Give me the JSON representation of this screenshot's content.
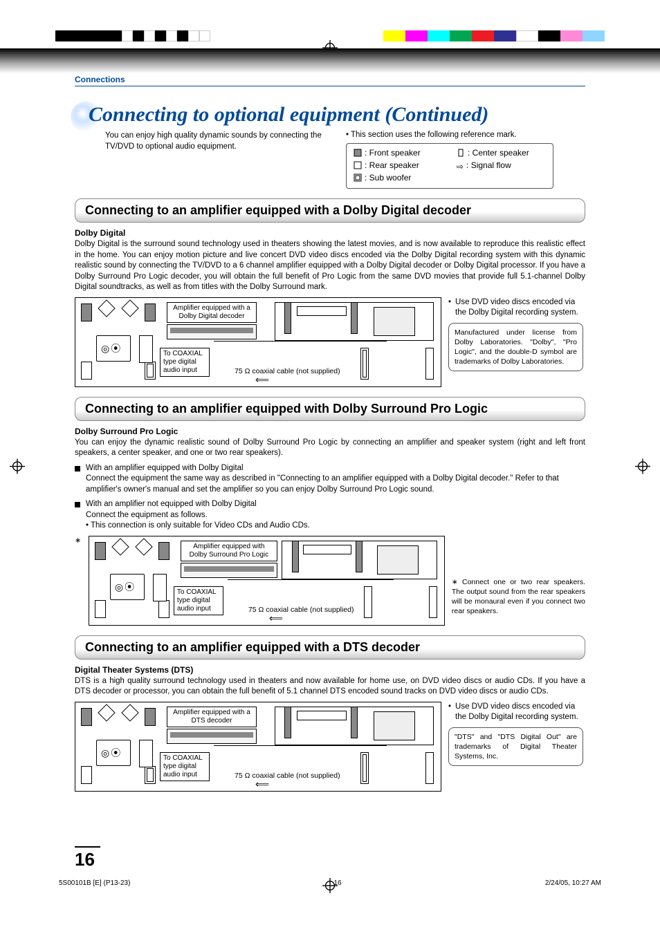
{
  "breadcrumb": "Connections",
  "title": "Connecting to optional equipment (Continued)",
  "intro_left": "You can enjoy high quality dynamic sounds by connecting the TV/DVD to optional audio equipment.",
  "intro_right": "• This section uses the following reference mark.",
  "legend": {
    "front": ": Front speaker",
    "rear": ": Rear speaker",
    "sub": ": Sub woofer",
    "center": ": Center speaker",
    "signal": ": Signal flow"
  },
  "sec1": {
    "heading": "Connecting to an amplifier equipped with a Dolby Digital decoder",
    "sub": "Dolby Digital",
    "para": "Dolby Digital is the surround sound technology used in theaters showing the latest movies, and is now available to reproduce this realistic effect in the home. You can enjoy motion picture and live concert DVD video discs encoded via the Dolby Digital recording system with this dynamic realistic sound by connecting the TV/DVD to a 6 channel amplifier equipped with a Dolby Digital decoder or Dolby Digital processor. If you have a Dolby Surround Pro Logic decoder, you will obtain the full benefit of Pro Logic from the same DVD movies that provide full 5.1-channel Dolby Digital soundtracks, as well as from titles with the Dolby Surround mark.",
    "amp_label": "Amplifier equipped with a Dolby Digital decoder",
    "coax_label": "To COAXIAL type digital audio input",
    "cable_label": "75 Ω coaxial cable (not supplied)",
    "side_bullet": "Use DVD video discs encoded via the Dolby Digital recording system.",
    "side_note": "Manufactured under license from Dolby Laboratories. \"Dolby\", \"Pro Logic\", and the double-D symbol are trademarks of Dolby Laboratories."
  },
  "sec2": {
    "heading": "Connecting to an amplifier equipped with Dolby Surround Pro Logic",
    "sub": "Dolby Surround Pro Logic",
    "para": "You can enjoy the dynamic realistic sound of Dolby Surround Pro Logic by connecting an amplifier and speaker system (right and left front speakers, a center speaker, and one or two rear speakers).",
    "b1_title": "With an amplifier equipped with Dolby Digital",
    "b1_body": "Connect the equipment the same way as described in \"Connecting to an amplifier equipped with a Dolby Digital decoder.\" Refer to that amplifier's owner's manual and set the amplifier so you can enjoy Dolby Surround Pro Logic sound.",
    "b2_title": "With an amplifier not equipped with Dolby Digital",
    "b2_body": "Connect the equipment as follows.",
    "b2_note": "• This connection is only suitable for Video CDs and Audio CDs.",
    "amp_label": "Amplifier equipped with Dolby Surround Pro Logic",
    "coax_label": "To COAXIAL type digital audio input",
    "cable_label": "75 Ω coaxial cable (not supplied)",
    "side_note": "∗ Connect one or two rear speakers. The output sound from the rear speakers will be monaural even if you connect two rear speakers."
  },
  "sec3": {
    "heading": "Connecting to an amplifier equipped with a DTS decoder",
    "sub": "Digital Theater Systems (DTS)",
    "para": "DTS is a high quality surround technology used in theaters and now available for home use, on DVD video discs or audio CDs. If you have a DTS decoder or processor, you can obtain the full benefit of 5.1 channel DTS encoded sound tracks on DVD video discs or audio CDs.",
    "amp_label": "Amplifier equipped with a DTS decoder",
    "coax_label": "To COAXIAL type digital audio input",
    "cable_label": "75 Ω coaxial cable (not supplied)",
    "side_bullet": "Use DVD video discs encoded via the Dolby Digital recording system.",
    "side_note": "\"DTS\" and \"DTS Digital Out\" are trademarks of Digital Theater Systems, Inc."
  },
  "page_number": "16",
  "footer": {
    "left": "5S00101B [E] (P13-23)",
    "center": "16",
    "right": "2/24/05, 10:27 AM"
  },
  "asterisk": "∗"
}
